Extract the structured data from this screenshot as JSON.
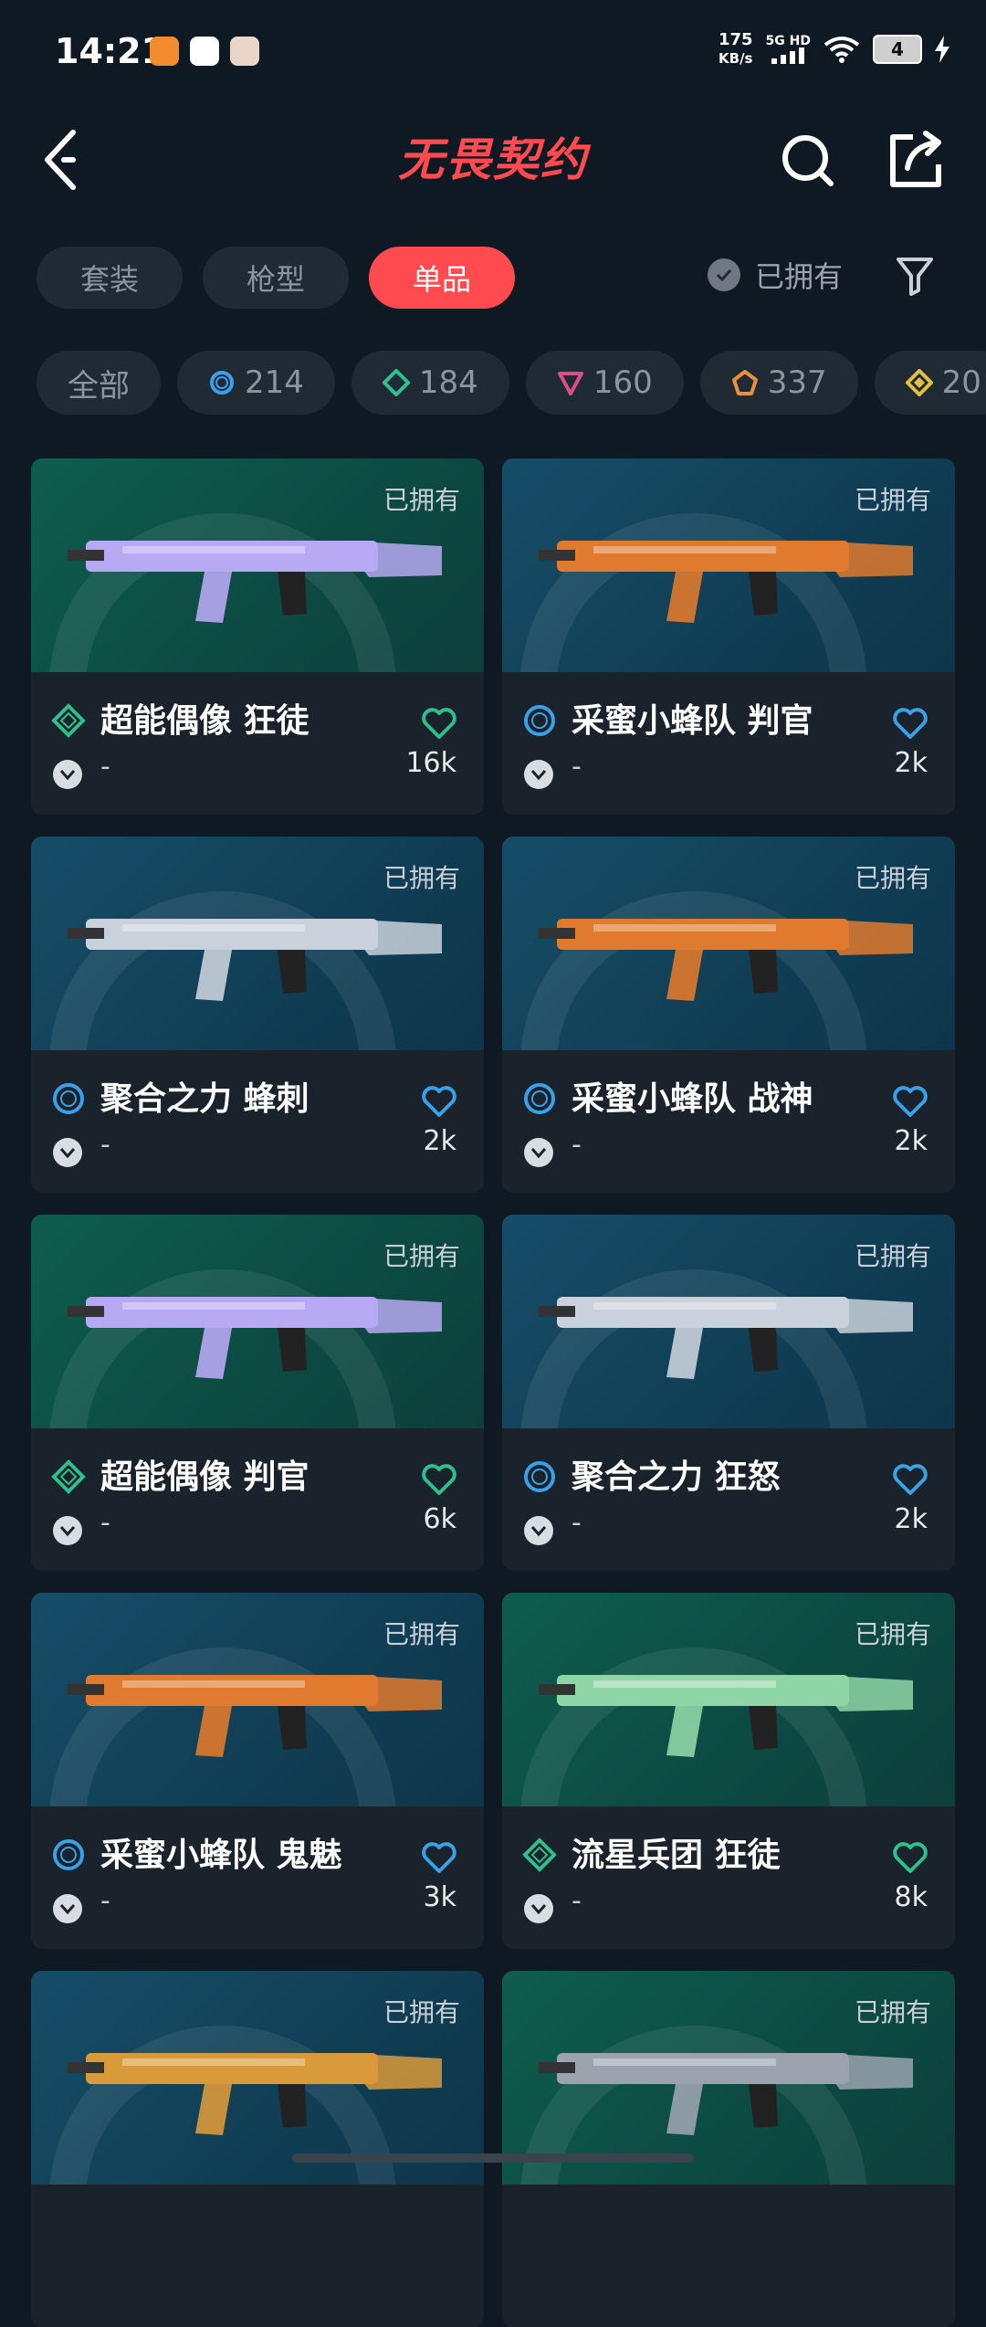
{
  "status_bar": {
    "time": "14:21",
    "net_speed_value": "175",
    "net_speed_unit": "KB/s",
    "signal_label": "5G HD",
    "battery_level": "4"
  },
  "header": {
    "title": "无畏契约"
  },
  "tabs": [
    {
      "label": "套装",
      "active": false
    },
    {
      "label": "枪型",
      "active": false
    },
    {
      "label": "单品",
      "active": true
    }
  ],
  "owned_filter": {
    "label": "已拥有"
  },
  "tier_filters": [
    {
      "label": "全部",
      "icon": null
    },
    {
      "label": "214",
      "icon": "tier-blue-ring-icon",
      "color": "#3aa0e8"
    },
    {
      "label": "184",
      "icon": "tier-green-diamond-icon",
      "color": "#2fbf8d"
    },
    {
      "label": "160",
      "icon": "tier-pink-triangle-icon",
      "color": "#d94f8a"
    },
    {
      "label": "337",
      "icon": "tier-orange-pentagon-icon",
      "color": "#e8903a"
    },
    {
      "label": "20",
      "icon": "tier-yellow-diamond-icon",
      "color": "#e0c040"
    }
  ],
  "skins": [
    {
      "name": "超能偶像 狂徒",
      "owned_label": "已拥有",
      "likes": "16k",
      "sub": "-",
      "tier": "green",
      "bg": "teal",
      "gun_color": "#b7a9f3"
    },
    {
      "name": "采蜜小蜂队 判官",
      "owned_label": "已拥有",
      "likes": "2k",
      "sub": "-",
      "tier": "blue",
      "bg": "blue",
      "gun_color": "#e07a2e"
    },
    {
      "name": "聚合之力 蜂刺",
      "owned_label": "已拥有",
      "likes": "2k",
      "sub": "-",
      "tier": "blue",
      "bg": "blue",
      "gun_color": "#c9d2dc"
    },
    {
      "name": "采蜜小蜂队 战神",
      "owned_label": "已拥有",
      "likes": "2k",
      "sub": "-",
      "tier": "blue",
      "bg": "blue",
      "gun_color": "#e07a2e"
    },
    {
      "name": "超能偶像 判官",
      "owned_label": "已拥有",
      "likes": "6k",
      "sub": "-",
      "tier": "green",
      "bg": "teal",
      "gun_color": "#b7a9f3"
    },
    {
      "name": "聚合之力 狂怒",
      "owned_label": "已拥有",
      "likes": "2k",
      "sub": "-",
      "tier": "blue",
      "bg": "blue",
      "gun_color": "#c9d2dc"
    },
    {
      "name": "采蜜小蜂队 鬼魅",
      "owned_label": "已拥有",
      "likes": "3k",
      "sub": "-",
      "tier": "blue",
      "bg": "blue",
      "gun_color": "#e07a2e"
    },
    {
      "name": "流星兵团 狂徒",
      "owned_label": "已拥有",
      "likes": "8k",
      "sub": "-",
      "tier": "green",
      "bg": "teal",
      "gun_color": "#8fd6a6"
    },
    {
      "name": "",
      "owned_label": "已拥有",
      "likes": "",
      "sub": "",
      "tier": "none",
      "bg": "blue",
      "gun_color": "#d99a3a"
    },
    {
      "name": "",
      "owned_label": "已拥有",
      "likes": "",
      "sub": "",
      "tier": "none",
      "bg": "teal",
      "gun_color": "#9aa3ae"
    }
  ],
  "colors": {
    "accent": "#ff4a4f",
    "background": "#0f1923",
    "tier_blue": "#3aa0e8",
    "tier_green": "#2fbf8d"
  }
}
